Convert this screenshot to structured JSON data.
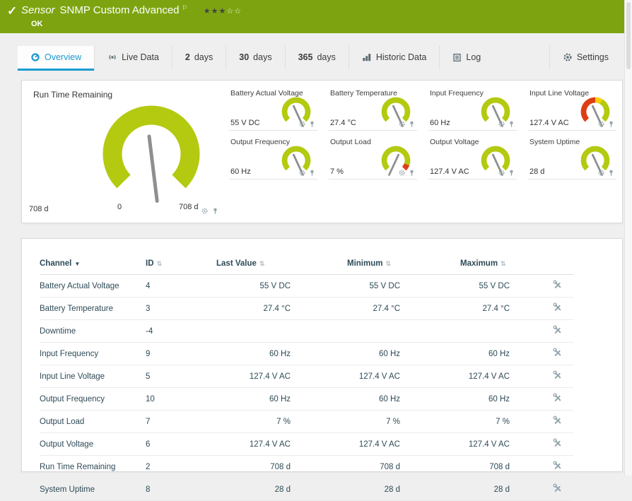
{
  "header": {
    "kind": "Sensor",
    "title": "SNMP Custom Advanced",
    "status": "OK",
    "stars_filled_glyphs": "★★★",
    "stars_empty_glyphs": "☆☆"
  },
  "icons": {
    "check": "✓",
    "flag": "⚐",
    "sort_desc": "▼",
    "sort_both": "⇅"
  },
  "colors": {
    "topbar_green": "#7da410",
    "gauge_lime": "#b4ca11",
    "alert_red": "#dd3f14",
    "warn_yellow": "#fccf0a",
    "active_blue": "#1b9ad2"
  },
  "tabs": [
    {
      "label": "Overview"
    },
    {
      "label": "Live Data"
    },
    {
      "num": "2",
      "label": "days"
    },
    {
      "num": "30",
      "label": "days"
    },
    {
      "num": "365",
      "label": "days"
    },
    {
      "label": "Historic Data"
    },
    {
      "label": "Log"
    },
    {
      "label": "Settings"
    }
  ],
  "gauges": {
    "main": {
      "title": "Run Time Remaining",
      "value": "708 d",
      "scale_min": "0",
      "scale_max": "708 d"
    },
    "small": [
      {
        "title": "Battery Actual Voltage",
        "value": "55 V DC"
      },
      {
        "title": "Battery Temperature",
        "value": "27.4 °C"
      },
      {
        "title": "Input Frequency",
        "value": "60 Hz"
      },
      {
        "title": "Input Line Voltage",
        "value": "127.4 V AC"
      },
      {
        "title": "Output Frequency",
        "value": "60 Hz"
      },
      {
        "title": "Output Load",
        "value": "7 %"
      },
      {
        "title": "Output Voltage",
        "value": "127.4 V AC"
      },
      {
        "title": "System Uptime",
        "value": "28 d"
      }
    ]
  },
  "table": {
    "headers": {
      "channel": "Channel",
      "id": "ID",
      "last_value": "Last Value",
      "minimum": "Minimum",
      "maximum": "Maximum"
    },
    "rows": [
      {
        "channel": "Battery Actual Voltage",
        "id": "4",
        "last": "55 V DC",
        "min": "55 V DC",
        "max": "55 V DC"
      },
      {
        "channel": "Battery Temperature",
        "id": "3",
        "last": "27.4 °C",
        "min": "27.4 °C",
        "max": "27.4 °C"
      },
      {
        "channel": "Downtime",
        "id": "-4",
        "last": "",
        "min": "",
        "max": ""
      },
      {
        "channel": "Input Frequency",
        "id": "9",
        "last": "60 Hz",
        "min": "60 Hz",
        "max": "60 Hz"
      },
      {
        "channel": "Input Line Voltage",
        "id": "5",
        "last": "127.4 V AC",
        "min": "127.4 V AC",
        "max": "127.4 V AC"
      },
      {
        "channel": "Output Frequency",
        "id": "10",
        "last": "60 Hz",
        "min": "60 Hz",
        "max": "60 Hz"
      },
      {
        "channel": "Output Load",
        "id": "7",
        "last": "7 %",
        "min": "7 %",
        "max": "7 %"
      },
      {
        "channel": "Output Voltage",
        "id": "6",
        "last": "127.4 V AC",
        "min": "127.4 V AC",
        "max": "127.4 V AC"
      },
      {
        "channel": "Run Time Remaining",
        "id": "2",
        "last": "708 d",
        "min": "708 d",
        "max": "708 d"
      },
      {
        "channel": "System Uptime",
        "id": "8",
        "last": "28 d",
        "min": "28 d",
        "max": "28 d"
      }
    ]
  }
}
